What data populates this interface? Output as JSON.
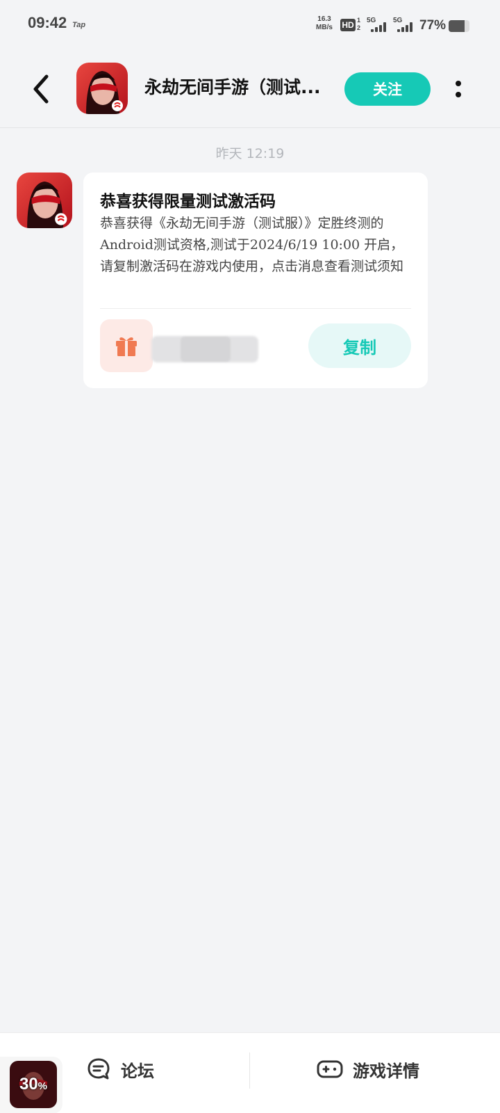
{
  "status_bar": {
    "time": "09:42",
    "app_tag": "Tap",
    "net_speed_value": "16.3",
    "net_speed_unit": "MB/s",
    "hd_badge": "HD",
    "hd_sup_top": "1",
    "hd_sup_bottom": "2",
    "signal1_label": "5G",
    "signal2_label": "5G",
    "battery_percent": "77%",
    "battery_level": 0.77
  },
  "header": {
    "back_icon": "chevron-left-icon",
    "title": "永劫无间手游（测试...",
    "follow_label": "关注",
    "more_icon": "more-vertical-icon",
    "accent_color": "#16c9b6"
  },
  "chat": {
    "timestamp": "昨天 12:19",
    "message": {
      "title": "恭喜获得限量测试激活码",
      "body": "恭喜获得《永劫无间手游（测试服）》定胜终测的Android测试资格,测试于2024/6/19 10:00 开启，请复制激活码在游戏内使用，点击消息查看测试须知",
      "gift_icon": "gift-icon",
      "copy_label": "复制"
    }
  },
  "bottom_bar": {
    "mini_game_progress": "30",
    "mini_game_progress_unit": "%",
    "forum_icon": "forum-chat-icon",
    "forum_label": "论坛",
    "details_icon": "gamepad-icon",
    "details_label": "游戏详情"
  }
}
